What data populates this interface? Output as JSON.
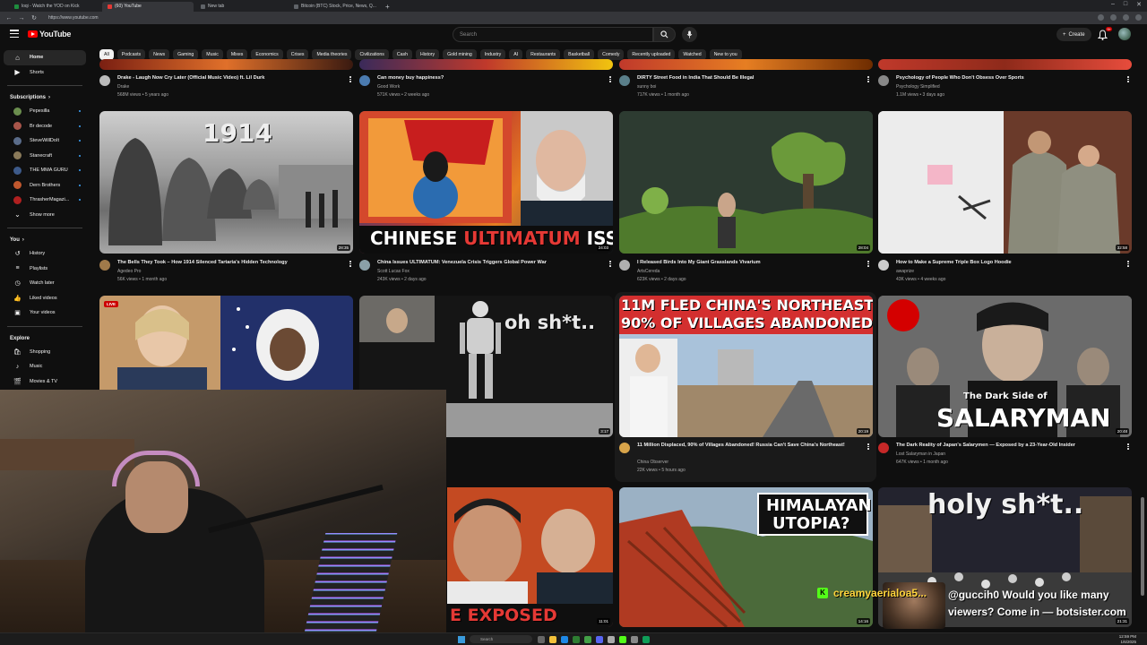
{
  "browser": {
    "tabs": [
      {
        "label": "loqi - Watch the YOD on Kick",
        "active": false
      },
      {
        "label": "(60) YouTube",
        "active": true
      },
      {
        "label": "New tab",
        "active": false
      },
      {
        "label": "Bitcoin (BTC) Stock, Price, News, Q...",
        "active": false
      }
    ],
    "url": "https://www.youtube.com"
  },
  "header": {
    "logo_text": "YouTube",
    "search_placeholder": "Search",
    "create_label": "Create",
    "notification_count": "9+"
  },
  "sidebar": {
    "main": [
      {
        "label": "Home",
        "icon": "home-icon",
        "active": true
      },
      {
        "label": "Shorts",
        "icon": "shorts-icon",
        "active": false
      }
    ],
    "subscriptions_title": "Subscriptions",
    "subscriptions": [
      {
        "label": "Pepesilla",
        "color": "#6b8e4e"
      },
      {
        "label": "Br decode",
        "color": "#a8554a"
      },
      {
        "label": "SteveWillDoIt",
        "color": "#5a6c8a"
      },
      {
        "label": "Stanecraft",
        "color": "#8a7a5a"
      },
      {
        "label": "THE MMA GURU",
        "color": "#3d5a8a"
      },
      {
        "label": "Dern Brothers",
        "color": "#c0582e"
      },
      {
        "label": "ThrasherMagazi...",
        "color": "#b02020"
      }
    ],
    "show_more": "Show more",
    "you_title": "You",
    "you_items": [
      {
        "label": "History",
        "icon": "history-icon"
      },
      {
        "label": "Playlists",
        "icon": "playlists-icon"
      },
      {
        "label": "Watch later",
        "icon": "watch-later-icon"
      },
      {
        "label": "Liked videos",
        "icon": "liked-videos-icon"
      },
      {
        "label": "Your videos",
        "icon": "your-videos-icon"
      }
    ],
    "explore_title": "Explore",
    "explore_items": [
      {
        "label": "Shopping",
        "icon": "shopping-icon"
      },
      {
        "label": "Music",
        "icon": "music-icon"
      },
      {
        "label": "Movies & TV",
        "icon": "movies-icon"
      }
    ]
  },
  "chips": [
    "All",
    "Podcasts",
    "News",
    "Gaming",
    "Music",
    "Mixes",
    "Economics",
    "Crises",
    "Media theories",
    "Civilizations",
    "Cash",
    "History",
    "Gold mining",
    "Industry",
    "AI",
    "Restaurants",
    "Basketball",
    "Comedy",
    "Recently uploaded",
    "Watched",
    "New to you"
  ],
  "row1": [
    {
      "title": "Drake - Laugh Now Cry Later (Official Music Video) ft. Lil Durk",
      "channel": "Drake",
      "meta": "568M views • 5 years ago"
    },
    {
      "title": "Can money buy happiness?",
      "channel": "Good Work",
      "meta": "571K views • 2 weeks ago"
    },
    {
      "title": "DIRTY Street Food in India That Should Be Illegal",
      "channel": "sunny boi",
      "meta": "717K views • 1 month ago"
    },
    {
      "title": "Psychology of People Who Don't Obsess Over Sports",
      "channel": "Psychology Simplified",
      "meta": "1.1M views • 3 days ago"
    }
  ],
  "row2": [
    {
      "title": "The Bells They Took – How 1914 Silenced Tartaria's Hidden Technology",
      "channel": "Agedeo Pro",
      "meta": "56K views • 1 month ago",
      "duration": "28:35",
      "overlay": "1914"
    },
    {
      "title": "China Issues ULTIMATUM: Venezuela Crisis Triggers Global Power War",
      "channel": "Scott Lucas Fox",
      "meta": "243K views • 2 days ago",
      "duration": "24:03",
      "overlay_white": "CHINESE ",
      "overlay_red": "ULTIMATUM",
      "overlay_white2": " ISSUED"
    },
    {
      "title": "I Released Birds Into My Giant Grasslands Vivarium",
      "channel": "ArtsCereda",
      "meta": "623K views • 2 days ago",
      "duration": "28:04"
    },
    {
      "title": "How to Make a Supreme Triple Box Logo Hoodie",
      "channel": "awaprize",
      "meta": "43K views • 4 weeks ago",
      "duration": "32:58"
    }
  ],
  "row3": [
    {
      "live": "LIVE"
    },
    {
      "overlay": "oh sh*t..",
      "duration": "3:17"
    },
    {
      "title": "11 Million Displaced, 90% of Villages Abandoned! Russia Can't Save China's Northeast!",
      "channel": "China Observer",
      "meta": "22K views • 5 hours ago",
      "duration": "20:19",
      "overlay_line1": "11M FLED CHINA'S NORTHEAST",
      "overlay_line2": "90% OF VILLAGES ABANDONED"
    },
    {
      "title": "The Dark Reality of Japan's Salarymen — Exposed by a 23-Year-Old Insider",
      "channel": "Lost Salaryman in Japan",
      "meta": "647K views • 1 month ago",
      "duration": "20:48",
      "overlay_small": "The Dark Side of",
      "overlay_big": "SALARYMAN"
    }
  ],
  "row4": [
    {
      "overlay": "E EXPOSED",
      "duration": "11:01"
    },
    {
      "overlay_line1": "HIMALAYAN",
      "overlay_line2": "UTOPIA?",
      "duration": "14:16"
    },
    {
      "overlay": "holy sh*t..",
      "duration": "21:31"
    }
  ],
  "stream": {
    "badge": "K",
    "user": "creamyaerialoa5...",
    "message": "@guccih0 Would you like many viewers? Come in — botsister.com"
  },
  "taskbar": {
    "search": "Search",
    "time": "12:59 PM",
    "date": "1/6/2025"
  }
}
